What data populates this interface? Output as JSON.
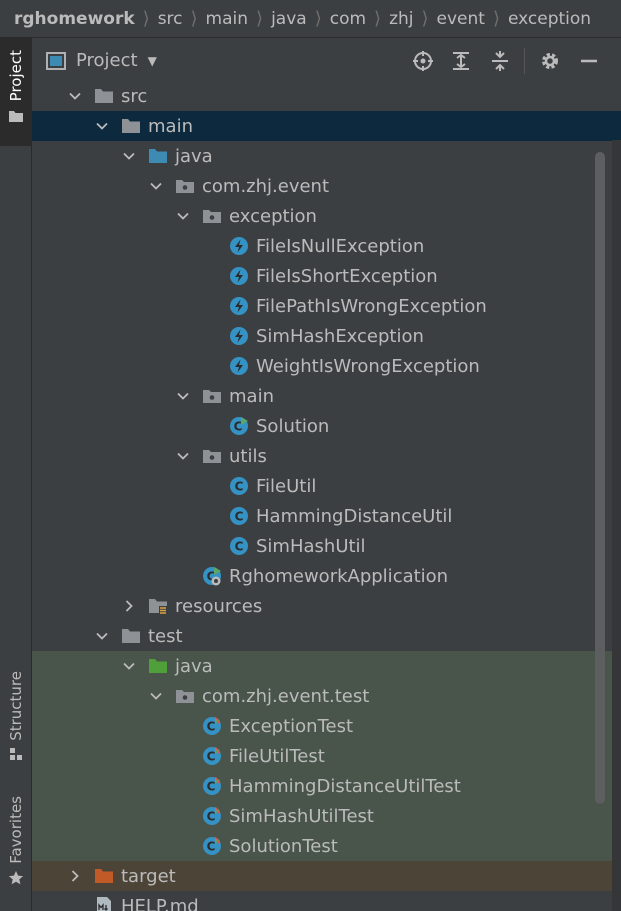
{
  "breadcrumb": {
    "items": [
      "rghomework",
      "src",
      "main",
      "java",
      "com",
      "zhj",
      "event",
      "exception"
    ]
  },
  "sidebar": {
    "project_label": "Project",
    "structure_label": "Structure",
    "favorites_label": "Favorites"
  },
  "panel": {
    "title": "Project",
    "dropdown_icon": "triangle-down-icon",
    "toolbar_icons": [
      "locate-icon",
      "expand-all-icon",
      "collapse-all-icon",
      "gear-icon",
      "minimize-icon"
    ]
  },
  "colors": {
    "background": "#3c3f41",
    "selected_row": "#0d293e",
    "test_rows": "#49544a",
    "excluded_row": "#4d4438",
    "folder_gray": "#8e9196",
    "source_folder_blue": "#3d8ab3",
    "test_folder_green": "#4fa03a",
    "excluded_folder_orange": "#c25a28",
    "class_cyan": "#3592c4"
  },
  "tree": [
    {
      "label": "src",
      "icon": "folder-icon",
      "expanded": true,
      "depth": 0,
      "style": ""
    },
    {
      "label": "main",
      "icon": "folder-icon",
      "expanded": true,
      "depth": 1,
      "style": "selected"
    },
    {
      "label": "java",
      "icon": "source-folder-icon",
      "expanded": true,
      "depth": 2,
      "style": ""
    },
    {
      "label": "com.zhj.event",
      "icon": "package-icon",
      "expanded": true,
      "depth": 3,
      "style": ""
    },
    {
      "label": "exception",
      "icon": "package-icon",
      "expanded": true,
      "depth": 4,
      "style": ""
    },
    {
      "label": "FileIsNullException",
      "icon": "exception-class-icon",
      "depth": 5,
      "style": ""
    },
    {
      "label": "FileIsShortException",
      "icon": "exception-class-icon",
      "depth": 5,
      "style": ""
    },
    {
      "label": "FilePathIsWrongException",
      "icon": "exception-class-icon",
      "depth": 5,
      "style": ""
    },
    {
      "label": "SimHashException",
      "icon": "exception-class-icon",
      "depth": 5,
      "style": ""
    },
    {
      "label": "WeightIsWrongException",
      "icon": "exception-class-icon",
      "depth": 5,
      "style": ""
    },
    {
      "label": "main",
      "icon": "package-icon",
      "expanded": true,
      "depth": 4,
      "style": ""
    },
    {
      "label": "Solution",
      "icon": "runnable-class-icon",
      "depth": 5,
      "style": ""
    },
    {
      "label": "utils",
      "icon": "package-icon",
      "expanded": true,
      "depth": 4,
      "style": ""
    },
    {
      "label": "FileUtil",
      "icon": "class-icon",
      "depth": 5,
      "style": ""
    },
    {
      "label": "HammingDistanceUtil",
      "icon": "class-icon",
      "depth": 5,
      "style": ""
    },
    {
      "label": "SimHashUtil",
      "icon": "class-icon",
      "depth": 5,
      "style": ""
    },
    {
      "label": "RghomeworkApplication",
      "icon": "spring-boot-class-icon",
      "depth": 4,
      "style": ""
    },
    {
      "label": "resources",
      "icon": "resources-folder-icon",
      "expanded": false,
      "depth": 2,
      "style": ""
    },
    {
      "label": "test",
      "icon": "folder-icon",
      "expanded": true,
      "depth": 1,
      "style": ""
    },
    {
      "label": "java",
      "icon": "test-folder-icon",
      "expanded": true,
      "depth": 2,
      "style": "green"
    },
    {
      "label": "com.zhj.event.test",
      "icon": "package-icon",
      "expanded": true,
      "depth": 3,
      "style": "green"
    },
    {
      "label": "ExceptionTest",
      "icon": "test-class-icon",
      "depth": 4,
      "style": "green"
    },
    {
      "label": "FileUtilTest",
      "icon": "test-class-icon",
      "depth": 4,
      "style": "green"
    },
    {
      "label": "HammingDistanceUtilTest",
      "icon": "test-class-icon",
      "depth": 4,
      "style": "green"
    },
    {
      "label": "SimHashUtilTest",
      "icon": "test-class-icon",
      "depth": 4,
      "style": "green"
    },
    {
      "label": "SolutionTest",
      "icon": "test-class-icon",
      "depth": 4,
      "style": "green"
    },
    {
      "label": "target",
      "icon": "excluded-folder-icon",
      "expanded": false,
      "depth": 0,
      "style": "brown"
    },
    {
      "label": "HELP.md",
      "icon": "markdown-file-icon",
      "depth": 0,
      "style": ""
    }
  ]
}
